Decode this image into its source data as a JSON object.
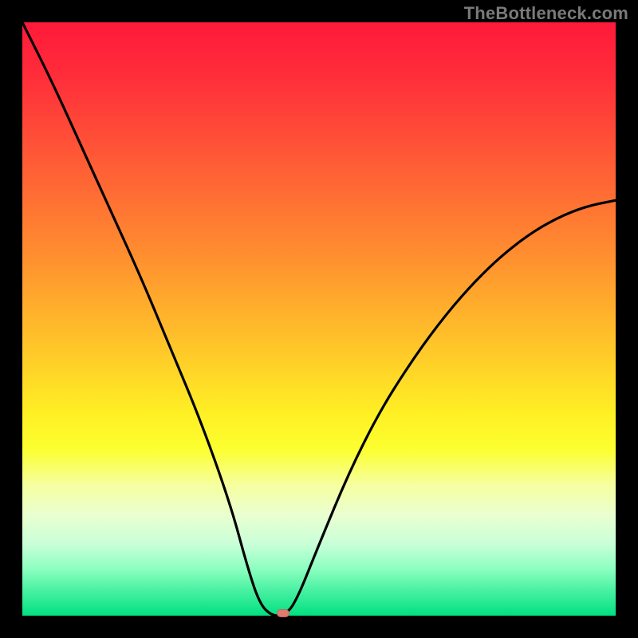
{
  "watermark": "TheBottleneck.com",
  "colors": {
    "frame": "#000000",
    "gradient_top": "#ff1a3a",
    "gradient_bottom": "#02e080",
    "curve": "#000000",
    "marker": "#e27a70"
  },
  "chart_data": {
    "type": "line",
    "title": "",
    "xlabel": "",
    "ylabel": "",
    "xlim": [
      0,
      100
    ],
    "ylim": [
      0,
      100
    ],
    "grid": false,
    "legend": false,
    "description": "Bottleneck curve: mismatch percentage (top=100, bottom=0) as a function of a hardware balance parameter (left=0, right=100). Steep decline on the left branch, flat optimal region near the minimum, then gradual rise on the right branch.",
    "series": [
      {
        "name": "bottleneck-curve",
        "x": [
          0,
          5,
          10,
          15,
          20,
          25,
          30,
          35,
          38,
          40,
          42,
          44,
          46,
          50,
          55,
          60,
          65,
          70,
          75,
          80,
          85,
          90,
          95,
          100
        ],
        "values": [
          100,
          90,
          79,
          68,
          57,
          45,
          33,
          19,
          8,
          2,
          0,
          0,
          2,
          12,
          24,
          34,
          42,
          49,
          55,
          60,
          64,
          67,
          69,
          70
        ]
      }
    ],
    "optimal_region": {
      "x_start": 40,
      "x_end": 44,
      "value": 0
    },
    "marker": {
      "x": 44,
      "y": 0
    },
    "annotations": []
  }
}
